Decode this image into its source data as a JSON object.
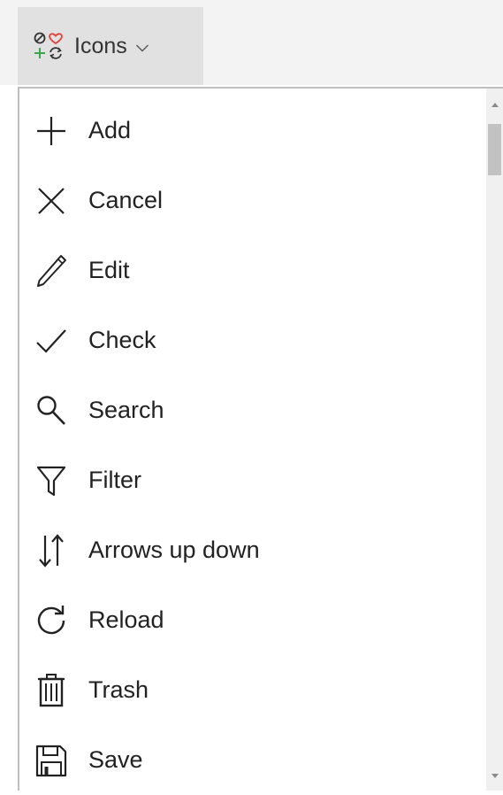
{
  "toolbar": {
    "icons_label": "Icons",
    "icons_tab_icon": "icon-set-icon",
    "chevron_icon": "chevron-down-icon"
  },
  "menu": {
    "items": [
      {
        "label": "Add",
        "icon": "plus-icon"
      },
      {
        "label": "Cancel",
        "icon": "x-icon"
      },
      {
        "label": "Edit",
        "icon": "pencil-icon"
      },
      {
        "label": "Check",
        "icon": "check-icon"
      },
      {
        "label": "Search",
        "icon": "magnifier-icon"
      },
      {
        "label": "Filter",
        "icon": "funnel-icon"
      },
      {
        "label": "Arrows up down",
        "icon": "arrows-up-down-icon"
      },
      {
        "label": "Reload",
        "icon": "reload-icon"
      },
      {
        "label": "Trash",
        "icon": "trash-icon"
      },
      {
        "label": "Save",
        "icon": "floppy-disk-icon"
      }
    ]
  },
  "colors": {
    "heart": "#e0433b",
    "plus_green": "#3aa84a",
    "icon_stroke": "#222222"
  }
}
